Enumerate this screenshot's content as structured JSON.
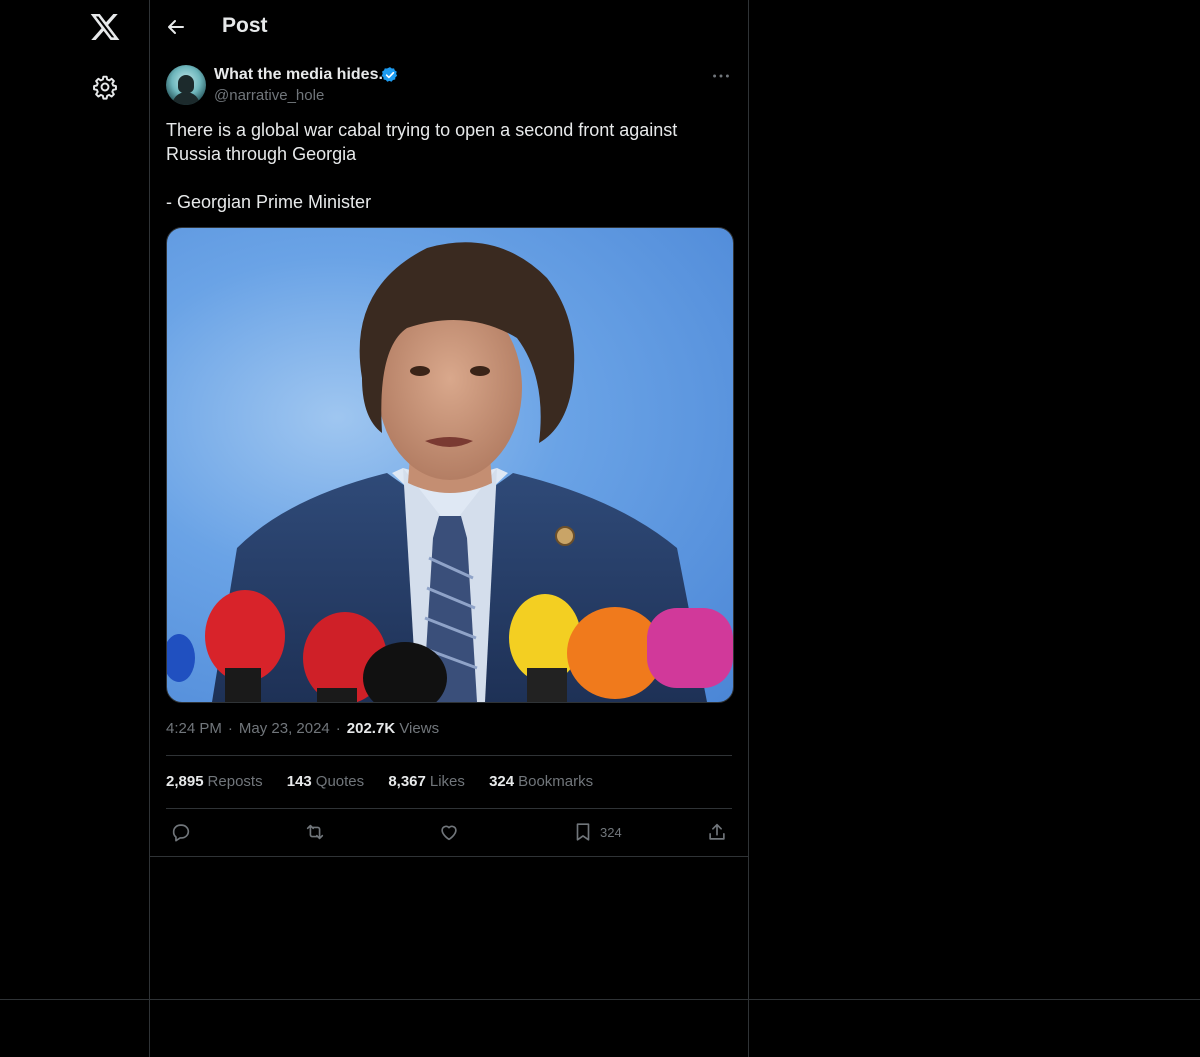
{
  "nav": {
    "logo_icon": "x-logo-icon",
    "settings_icon": "gear-icon"
  },
  "header": {
    "title": "Post",
    "back_icon": "arrow-left-icon"
  },
  "post": {
    "display_name": "What the media hides.",
    "verified": true,
    "handle": "@narrative_hole",
    "text": "There is a global war cabal trying to open a second front against Russia through Georgia\n\n- Georgian Prime Minister",
    "image_alt": "Photo of a man in a blue suit speaking to a cluster of news microphones",
    "time": "4:24 PM",
    "date": "May 23, 2024",
    "views_count": "202.7K",
    "views_label": "Views",
    "stats": [
      {
        "count": "2,895",
        "label": "Reposts"
      },
      {
        "count": "143",
        "label": "Quotes"
      },
      {
        "count": "8,367",
        "label": "Likes"
      },
      {
        "count": "324",
        "label": "Bookmarks"
      }
    ],
    "actions": {
      "reply_icon": "reply-icon",
      "repost_icon": "repost-icon",
      "like_icon": "heart-icon",
      "bookmark_icon": "bookmark-icon",
      "bookmark_count": "324",
      "share_icon": "share-icon"
    }
  },
  "colors": {
    "background": "#000000",
    "text": "#e7e9ea",
    "secondary": "#71767b",
    "border": "#2f3336",
    "verified": "#1d9bf0"
  }
}
